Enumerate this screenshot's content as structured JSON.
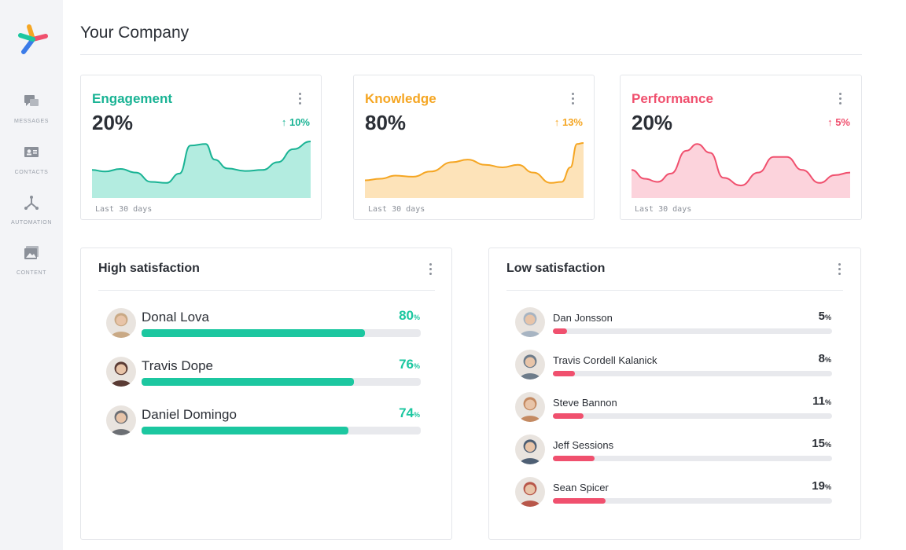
{
  "header": {
    "title": "Your Company"
  },
  "sidebar": {
    "items": [
      {
        "label": "MESSAGES",
        "icon": "messages-icon"
      },
      {
        "label": "CONTACTS",
        "icon": "contacts-icon"
      },
      {
        "label": "AUTOMATION",
        "icon": "automation-icon"
      },
      {
        "label": "CONTENT",
        "icon": "content-icon"
      }
    ]
  },
  "metrics": [
    {
      "title": "Engagement",
      "value": "20%",
      "delta": "10%",
      "color": "#19b394",
      "fill": "#b3ece0",
      "period": "Last 30 days",
      "curve": [
        [
          0,
          0.55
        ],
        [
          0.06,
          0.58
        ],
        [
          0.13,
          0.53
        ],
        [
          0.2,
          0.6
        ],
        [
          0.27,
          0.78
        ],
        [
          0.34,
          0.8
        ],
        [
          0.4,
          0.62
        ],
        [
          0.45,
          0.08
        ],
        [
          0.52,
          0.05
        ],
        [
          0.56,
          0.35
        ],
        [
          0.62,
          0.52
        ],
        [
          0.7,
          0.57
        ],
        [
          0.78,
          0.55
        ],
        [
          0.85,
          0.4
        ],
        [
          0.92,
          0.15
        ],
        [
          1,
          0.0
        ]
      ]
    },
    {
      "title": "Knowledge",
      "value": "80%",
      "delta": "13%",
      "color": "#f5a623",
      "fill": "#fde3b9",
      "period": "Last 30 days",
      "curve": [
        [
          0,
          0.75
        ],
        [
          0.07,
          0.72
        ],
        [
          0.14,
          0.66
        ],
        [
          0.22,
          0.68
        ],
        [
          0.3,
          0.58
        ],
        [
          0.4,
          0.4
        ],
        [
          0.47,
          0.35
        ],
        [
          0.55,
          0.45
        ],
        [
          0.63,
          0.5
        ],
        [
          0.7,
          0.45
        ],
        [
          0.77,
          0.6
        ],
        [
          0.85,
          0.8
        ],
        [
          0.9,
          0.78
        ],
        [
          0.94,
          0.5
        ],
        [
          0.97,
          0.05
        ],
        [
          1,
          0.03
        ]
      ]
    },
    {
      "title": "Performance",
      "value": "20%",
      "delta": "5%",
      "color": "#f0506e",
      "fill": "#fcd3dc",
      "period": "Last 30 days",
      "curve": [
        [
          0,
          0.55
        ],
        [
          0.06,
          0.72
        ],
        [
          0.12,
          0.78
        ],
        [
          0.18,
          0.62
        ],
        [
          0.25,
          0.18
        ],
        [
          0.3,
          0.05
        ],
        [
          0.36,
          0.22
        ],
        [
          0.42,
          0.7
        ],
        [
          0.5,
          0.85
        ],
        [
          0.58,
          0.6
        ],
        [
          0.65,
          0.3
        ],
        [
          0.71,
          0.3
        ],
        [
          0.78,
          0.55
        ],
        [
          0.86,
          0.8
        ],
        [
          0.93,
          0.65
        ],
        [
          1,
          0.6
        ]
      ]
    }
  ],
  "high_satisfaction": {
    "title": "High satisfaction",
    "color": "#1cc7a0",
    "people": [
      {
        "name": "Donal Lova",
        "pct": 80,
        "pct_text": "80",
        "avatar_bg": "#c9a985"
      },
      {
        "name": "Travis Dope",
        "pct": 76,
        "pct_text": "76",
        "avatar_bg": "#5a3b34"
      },
      {
        "name": "Daniel Domingo",
        "pct": 74,
        "pct_text": "74",
        "avatar_bg": "#6c6f74"
      }
    ]
  },
  "low_satisfaction": {
    "title": "Low satisfaction",
    "color": "#f0506e",
    "people": [
      {
        "name": "Dan Jonsson",
        "pct": 5,
        "pct_text": "5",
        "avatar_bg": "#a7b4c2"
      },
      {
        "name": "Travis Cordell Kalanick",
        "pct": 8,
        "pct_text": "8",
        "avatar_bg": "#6e7c8a"
      },
      {
        "name": "Steve Bannon",
        "pct": 11,
        "pct_text": "11",
        "avatar_bg": "#c48a62"
      },
      {
        "name": "Jeff Sessions",
        "pct": 15,
        "pct_text": "15",
        "avatar_bg": "#4e5f74"
      },
      {
        "name": "Sean Spicer",
        "pct": 19,
        "pct_text": "19",
        "avatar_bg": "#b8574a"
      }
    ]
  },
  "percent_sign": "%"
}
